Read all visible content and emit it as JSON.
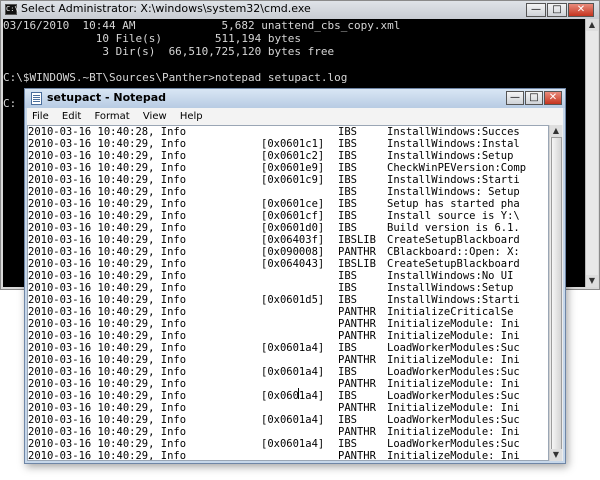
{
  "cmd": {
    "title": "Select Administrator: X:\\windows\\system32\\cmd.exe",
    "icon": "cmd-icon",
    "lines": [
      "03/16/2010  10:44 AM             5,682 unattend_cbs_copy.xml",
      "              10 File(s)        511,194 bytes",
      "               3 Dir(s)  66,510,725,120 bytes free",
      "",
      "C:\\$WINDOWS.~BT\\Sources\\Panther>notepad setupact.log",
      "",
      "C:"
    ]
  },
  "notepad": {
    "title": "setupact - Notepad",
    "menu": [
      "File",
      "Edit",
      "Format",
      "View",
      "Help"
    ],
    "rows": [
      {
        "date": "2010-03-16 10:40:28, Info",
        "code": "",
        "src": "IBS",
        "msg": "InstallWindows:Succes"
      },
      {
        "date": "2010-03-16 10:40:29, Info",
        "code": "[0x0601c1]",
        "src": "IBS",
        "msg": "InstallWindows:Instal"
      },
      {
        "date": "2010-03-16 10:40:29, Info",
        "code": "[0x0601c2]",
        "src": "IBS",
        "msg": "InstallWindows:Setup"
      },
      {
        "date": "2010-03-16 10:40:29, Info",
        "code": "[0x0601e9]",
        "src": "IBS",
        "msg": "CheckWinPEVersion:Comp"
      },
      {
        "date": "2010-03-16 10:40:29, Info",
        "code": "[0x0601c9]",
        "src": "IBS",
        "msg": "InstallWindows:Starti"
      },
      {
        "date": "2010-03-16 10:40:29, Info",
        "code": "",
        "src": "IBS",
        "msg": "InstallWindows: Setup"
      },
      {
        "date": "2010-03-16 10:40:29, Info",
        "code": "[0x0601ce]",
        "src": "IBS",
        "msg": "Setup has started pha"
      },
      {
        "date": "2010-03-16 10:40:29, Info",
        "code": "[0x0601cf]",
        "src": "IBS",
        "msg": "Install source is Y:\\"
      },
      {
        "date": "2010-03-16 10:40:29, Info",
        "code": "[0x0601d0]",
        "src": "IBS",
        "msg": "Build version is 6.1."
      },
      {
        "date": "2010-03-16 10:40:29, Info",
        "code": "[0x06403f]",
        "src": "IBSLIB",
        "msg": "CreateSetupBlackboard"
      },
      {
        "date": "2010-03-16 10:40:29, Info",
        "code": "[0x090008]",
        "src": "PANTHR",
        "msg": "CBlackboard::Open: X:"
      },
      {
        "date": "2010-03-16 10:40:29, Info",
        "code": "[0x064043]",
        "src": "IBSLIB",
        "msg": "CreateSetupBlackboard"
      },
      {
        "date": "2010-03-16 10:40:29, Info",
        "code": "",
        "src": "IBS",
        "msg": "InstallWindows:No UI"
      },
      {
        "date": "2010-03-16 10:40:29, Info",
        "code": "",
        "src": "IBS",
        "msg": "InstallWindows:Setup"
      },
      {
        "date": "2010-03-16 10:40:29, Info",
        "code": "[0x0601d5]",
        "src": "IBS",
        "msg": "InstallWindows:Starti"
      },
      {
        "date": "2010-03-16 10:40:29, Info",
        "code": "",
        "src": "PANTHR",
        "msg": "InitializeCriticalSe"
      },
      {
        "date": "2010-03-16 10:40:29, Info",
        "code": "",
        "src": "PANTHR",
        "msg": "InitializeModule: Ini"
      },
      {
        "date": "2010-03-16 10:40:29, Info",
        "code": "",
        "src": "PANTHR",
        "msg": "InitializeModule: Ini"
      },
      {
        "date": "2010-03-16 10:40:29, Info",
        "code": "[0x0601a4]",
        "src": "IBS",
        "msg": "LoadWorkerModules:Suc"
      },
      {
        "date": "2010-03-16 10:40:29, Info",
        "code": "",
        "src": "PANTHR",
        "msg": "InitializeModule: Ini"
      },
      {
        "date": "2010-03-16 10:40:29, Info",
        "code": "[0x0601a4]",
        "src": "IBS",
        "msg": "LoadWorkerModules:Suc"
      },
      {
        "date": "2010-03-16 10:40:29, Info",
        "code": "",
        "src": "PANTHR",
        "msg": "InitializeModule: Ini"
      },
      {
        "date": "2010-03-16 10:40:29, Info",
        "code": "[0x0601a4]",
        "src": "IBS",
        "msg": "LoadWorkerModules:Suc"
      },
      {
        "date": "2010-03-16 10:40:29, Info",
        "code": "",
        "src": "PANTHR",
        "msg": "InitializeModule: Ini"
      },
      {
        "date": "2010-03-16 10:40:29, Info",
        "code": "[0x0601a4]",
        "src": "IBS",
        "msg": "LoadWorkerModules:Suc"
      },
      {
        "date": "2010-03-16 10:40:29, Info",
        "code": "",
        "src": "PANTHR",
        "msg": "InitializeModule: Ini"
      },
      {
        "date": "2010-03-16 10:40:29, Info",
        "code": "[0x0601a4]",
        "src": "IBS",
        "msg": "LoadWorkerModules:Suc"
      },
      {
        "date": "2010-03-16 10:40:29, Info",
        "code": "",
        "src": "PANTHR",
        "msg": "InitializeModule: Ini"
      }
    ]
  },
  "colors": {
    "console_bg": "#000000",
    "console_text": "#d6d6d6",
    "notepad_frame": "#c6d7ea",
    "close_red": "#c4341f"
  }
}
